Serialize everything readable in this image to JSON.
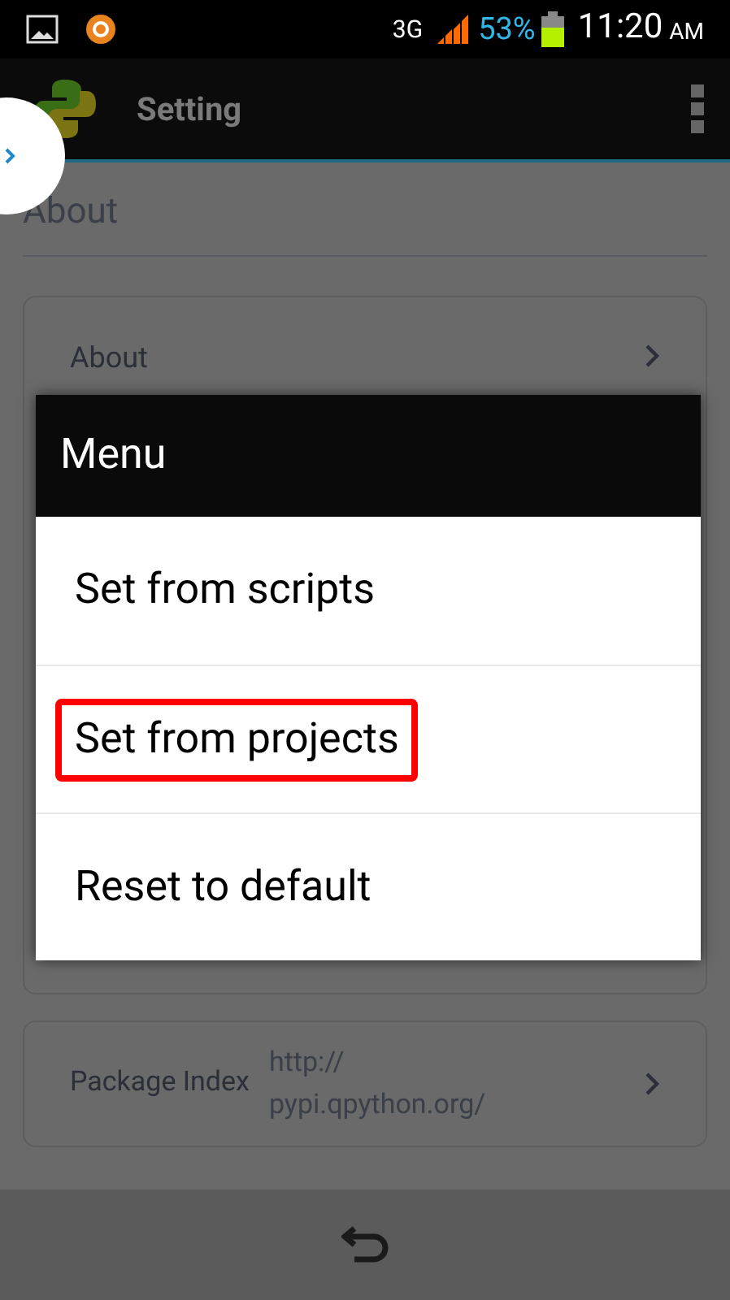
{
  "status_bar": {
    "network": "3G",
    "battery": "53%",
    "time": "11:20",
    "ampm": "AM"
  },
  "action_bar": {
    "title": "Setting"
  },
  "section": {
    "title": "About"
  },
  "cards": [
    {
      "label": "About"
    },
    {
      "label": "Package Index",
      "value": "http://\npypi.qpython.org/"
    }
  ],
  "dialog": {
    "title": "Menu",
    "items": [
      {
        "label": "Set from scripts",
        "highlighted": false
      },
      {
        "label": "Set from projects",
        "highlighted": true
      },
      {
        "label": "Reset to default",
        "highlighted": false
      }
    ]
  }
}
